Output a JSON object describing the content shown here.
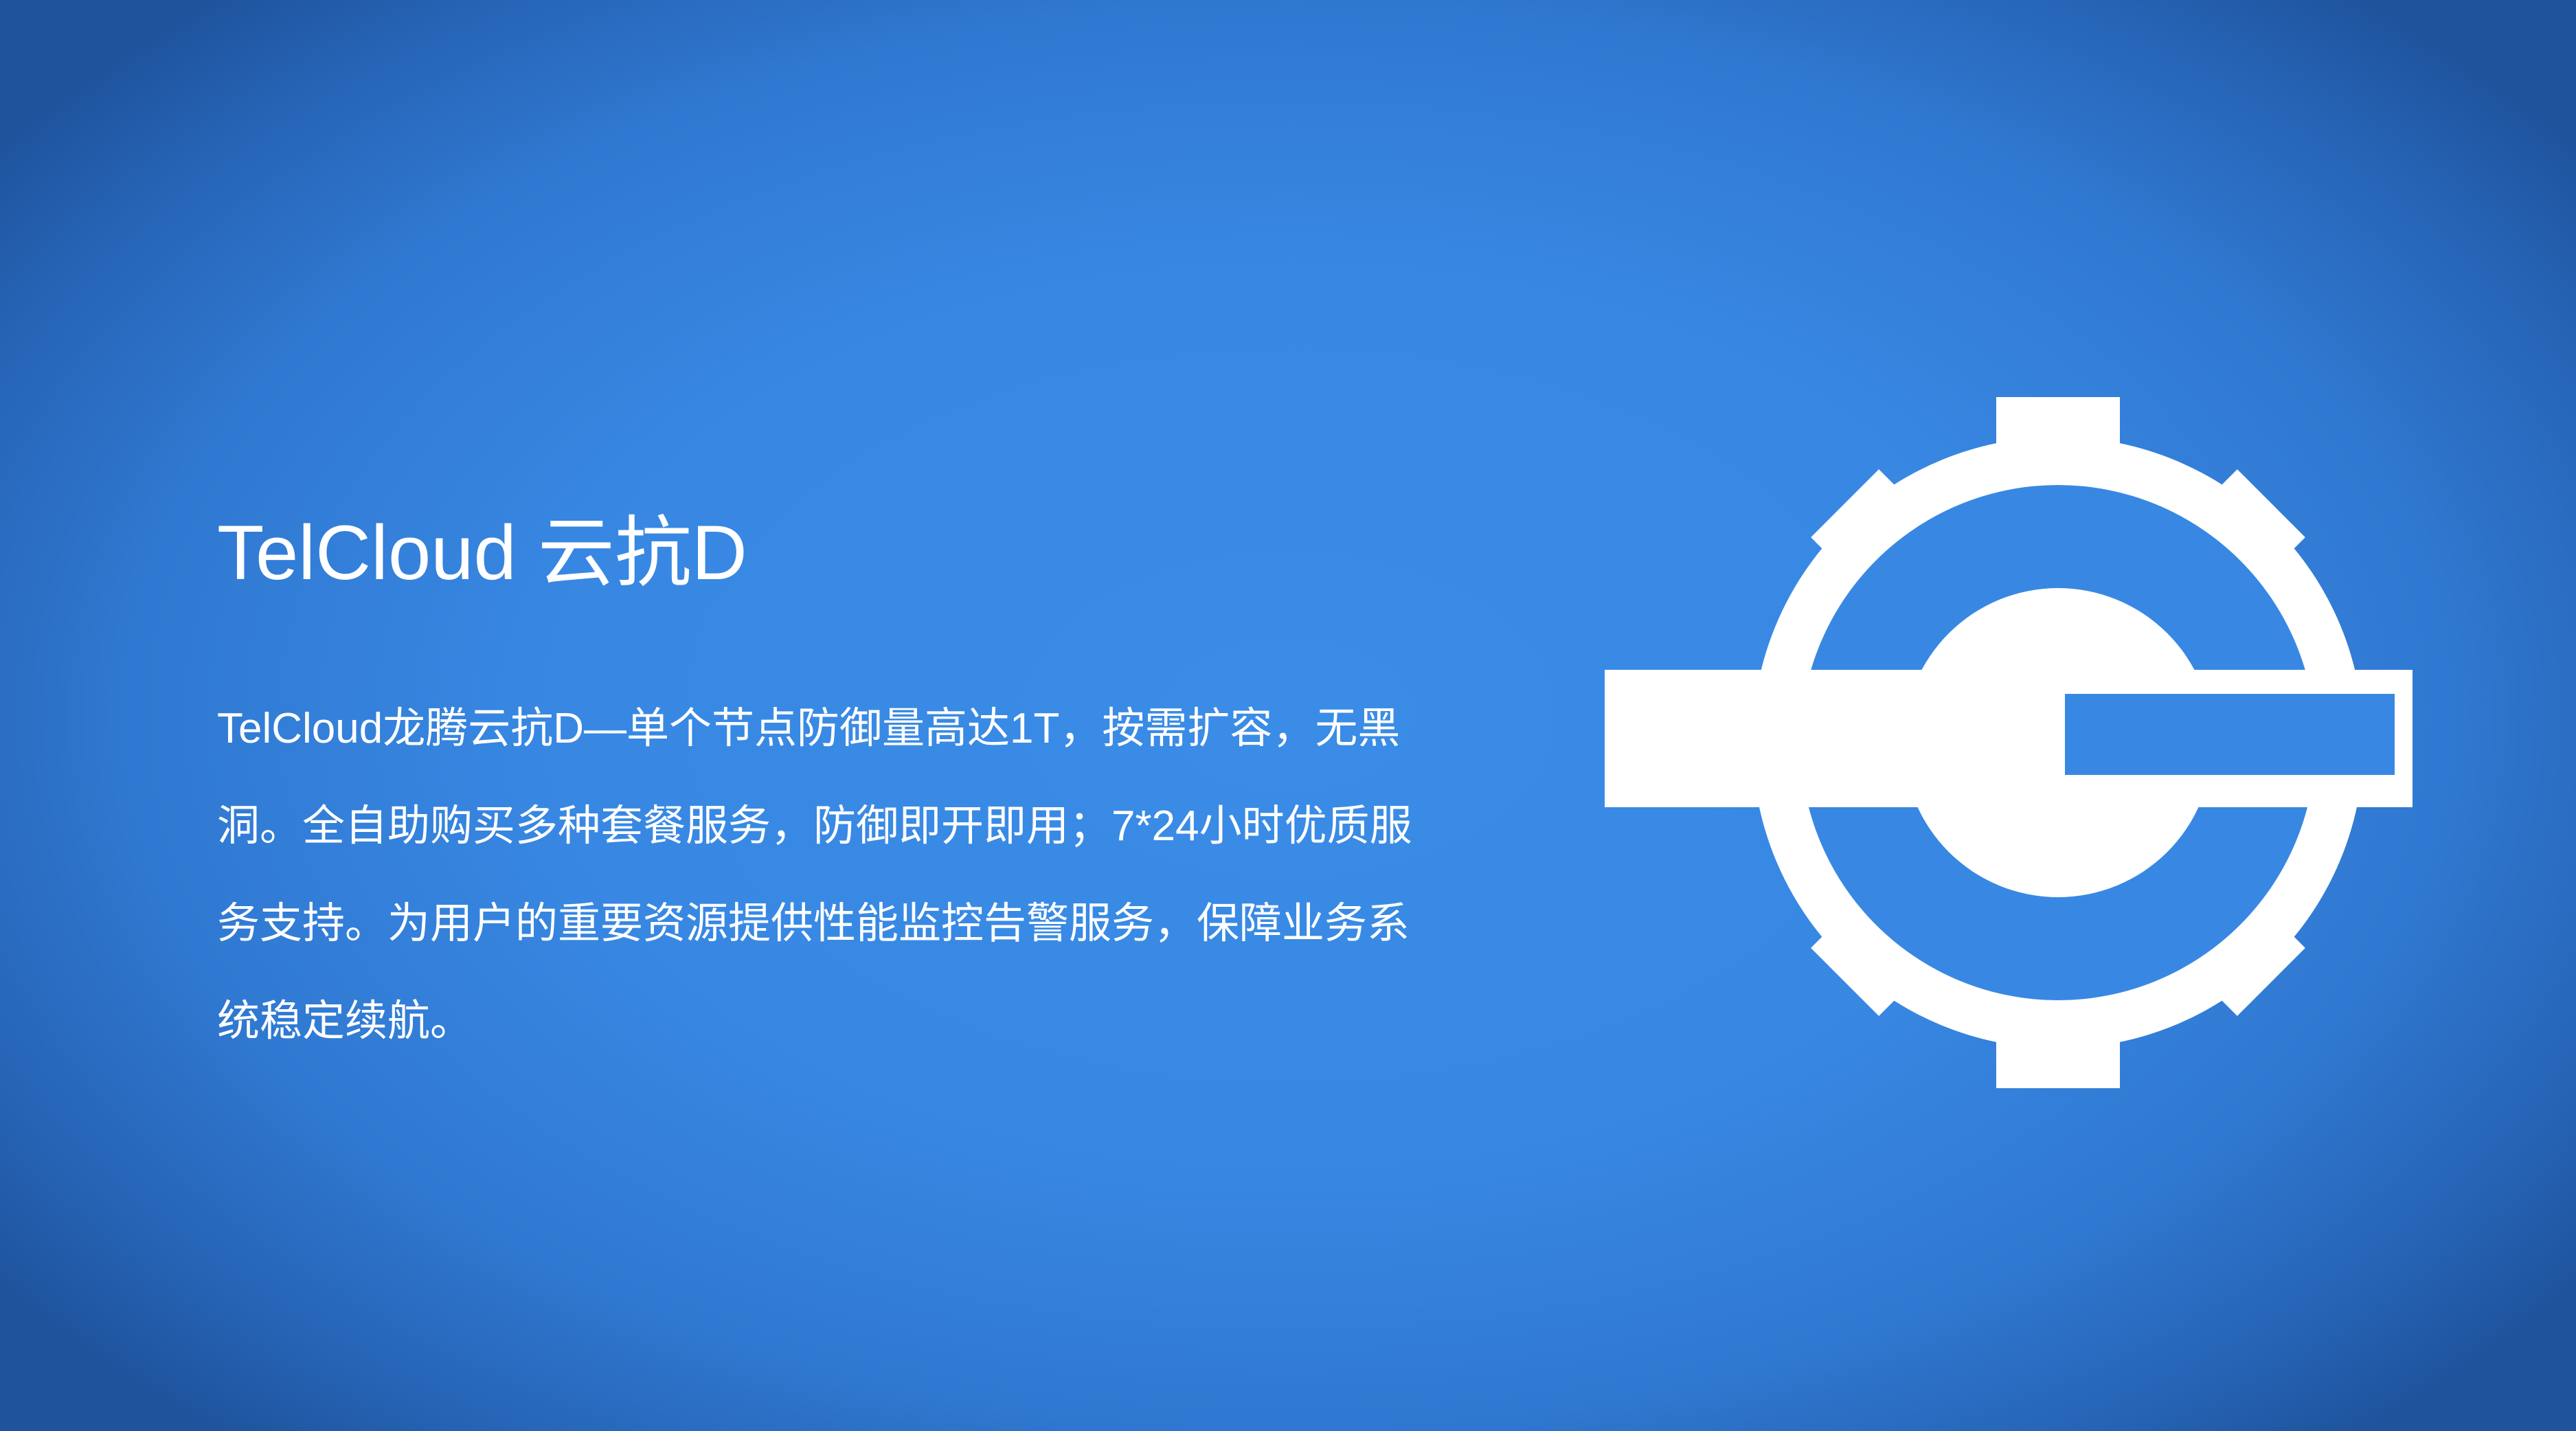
{
  "slide": {
    "title": "TelCloud 云抗D",
    "body_lines": [
      "TelCloud龙腾云抗D—单个节点防御量高达1T，按需扩容，无黑",
      "洞。全自助购买多种套餐服务，防御即开即用；7*24小时优质服",
      "务支持。为用户的重要资源提供性能监控告警服务，保障业务系",
      "统稳定续航。"
    ]
  },
  "logo": {
    "icon": "gear-wrench-icon",
    "color": "#ffffff"
  },
  "colors": {
    "background_center": "#3a8ce6",
    "background_edge": "#1f539c",
    "text": "#ffffff"
  }
}
